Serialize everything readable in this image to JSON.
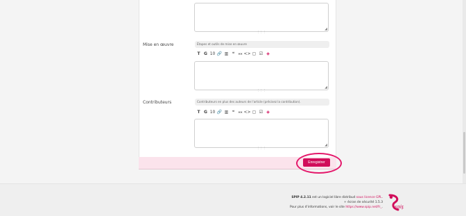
{
  "form": {
    "fields": [
      {
        "label": "Mise en œuvre",
        "hint": "Étapes et outils de mise en œuvre"
      },
      {
        "label": "Contributeurs",
        "hint": "Contributeurs en plus des auteurs de l'article (précisez la contribution)."
      }
    ],
    "toolbar": [
      "T",
      "G",
      "10",
      "🔗",
      "▥",
      "❝",
      "⁎⁎",
      "<>",
      "▢",
      "☑",
      "◈"
    ],
    "resize_glyph": "◢",
    "grip_glyph": "⋮⋮⋮",
    "save_label": "Enregistrer"
  },
  "footer": {
    "line1": {
      "brand": "SPIP 4.2.11",
      "mid": " est un logiciel libre distribué ",
      "link": "sous licence GPL",
      "end": "."
    },
    "line2": "+ écran de sécurité 1.5.3",
    "line3": {
      "text": "Pour plus d'informations, voir le site ",
      "link": "https://www.spip.net/fr_",
      "end": "."
    },
    "logo_text": "spip"
  },
  "colors": {
    "accent": "#d10d5a",
    "highlight": "#e4176a",
    "footer_bar": "#fbe3ec"
  }
}
